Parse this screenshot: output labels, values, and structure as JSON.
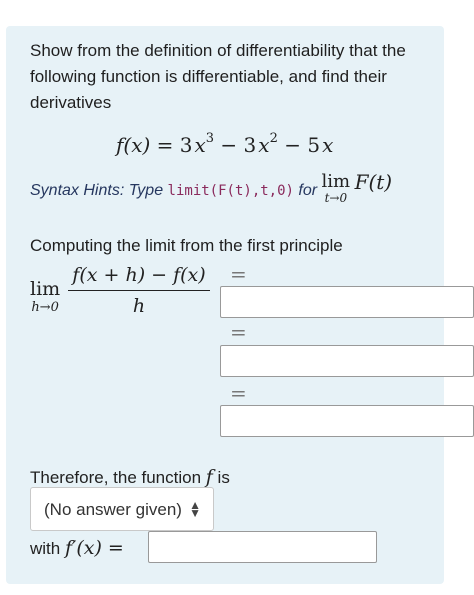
{
  "problem": {
    "prompt": "Show from the definition of differentiability that the following function is differentiable, and find their derivatives",
    "function_lhs": "f(x) = ",
    "coef1": "3",
    "var1": "x",
    "exp1": "3",
    "coef2": "3",
    "var2": "x",
    "exp2": "2",
    "coef3": "5",
    "var3": "x"
  },
  "hint": {
    "prefix": "Syntax Hints: Type ",
    "code": "limit(F(t),t,0)",
    "for_text": " for ",
    "lim": "lim",
    "lim_sub": "t→0",
    "expr": "F(t)"
  },
  "limit_section": {
    "heading": "Computing the limit from the first principle",
    "lim": "lim",
    "lim_sub": "h→0",
    "numerator": "f(x + h) − f(x)",
    "denominator": "h",
    "equals": "="
  },
  "answers": {
    "field1_value": "",
    "field2_value": "",
    "field3_value": "",
    "derivative_value": ""
  },
  "conclusion": {
    "therefore_text": "Therefore, the function ",
    "f": "f",
    "is_text": " is",
    "select_value": "(No answer given)",
    "with_text": "with ",
    "derivative_label": "f′(x) ="
  }
}
